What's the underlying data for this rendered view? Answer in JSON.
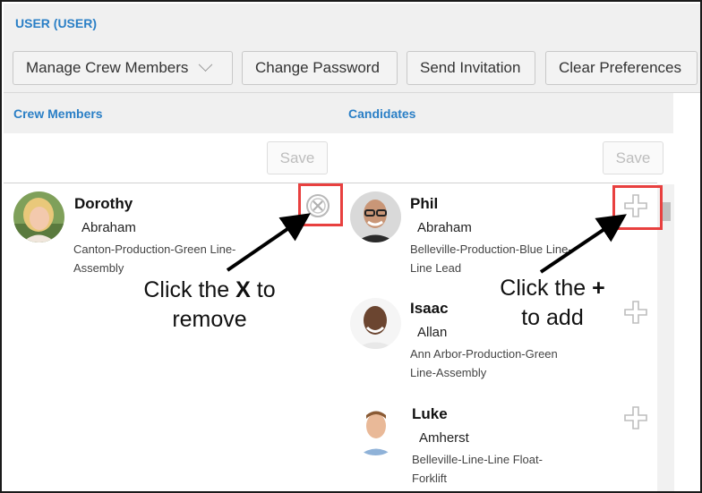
{
  "header": {
    "title": "USER (USER)"
  },
  "toolbar": {
    "manage_label": "Manage Crew Members",
    "change_password_label": "Change Password",
    "send_invitation_label": "Send Invitation",
    "clear_preferences_label": "Clear Preferences"
  },
  "crew": {
    "heading": "Crew Members",
    "save_label": "Save",
    "members": [
      {
        "first": "Dorothy",
        "last": "Abraham",
        "info_line1": "Canton-Production-Green Line-",
        "info_line2": "Assembly"
      }
    ]
  },
  "candidates": {
    "heading": "Candidates",
    "save_label": "Save",
    "people": [
      {
        "first": "Phil",
        "last": "Abraham",
        "info_line1": "Belleville-Production-Blue Line-",
        "info_line2": "Line Lead"
      },
      {
        "first": "Isaac",
        "last": "Allan",
        "info_line1": "Ann Arbor-Production-Green",
        "info_line2": "Line-Assembly"
      },
      {
        "first": "Luke",
        "last": "Amherst",
        "info_line1": "Belleville-Line-Line Float-",
        "info_line2": "Forklift"
      }
    ]
  },
  "annotations": {
    "remove_pre": "Click the ",
    "remove_key": "X",
    "remove_post": " to",
    "remove_line2": "remove",
    "add_pre": "Click the ",
    "add_key": "+",
    "add_line2": "to add"
  },
  "colors": {
    "accent": "#2a7fc6",
    "highlight": "#e8403f"
  },
  "icons": {
    "remove": "close-circle-icon",
    "add": "plus-icon",
    "dropdown": "chevron-down-icon"
  }
}
